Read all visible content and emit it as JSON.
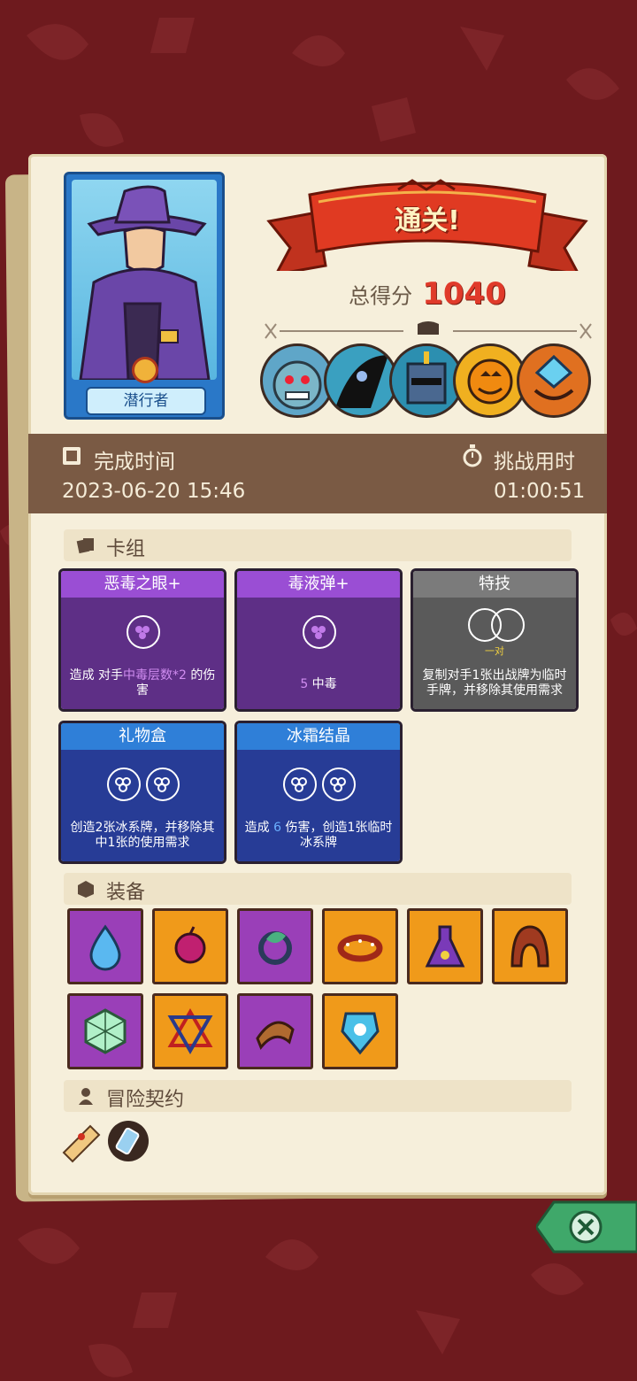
{
  "result": {
    "banner": "通关!",
    "score_label": "总得分",
    "score_value": "1040"
  },
  "hero": {
    "name": "潜行者"
  },
  "time": {
    "finish_label": "完成时间",
    "finish_value": "2023-06-20 15:46",
    "challenge_label": "挑战用时",
    "challenge_value": "01:00:51"
  },
  "deck": {
    "title": "卡组",
    "cards": [
      {
        "name": "恶毒之眼+",
        "color": "purple",
        "desc_prefix": "造成 对手",
        "desc_highlight": "中毒层数*2",
        "desc_suffix": " 的伤害"
      },
      {
        "name": "毒液弹+",
        "color": "purple",
        "desc_value": "5",
        "desc_suffix": " 中毒"
      },
      {
        "name": "特技",
        "color": "gray",
        "slot_label": "一对",
        "desc": "复制对手1张出战牌为临时手牌，并移除其使用需求"
      },
      {
        "name": "礼物盒",
        "color": "blue",
        "desc": "创造2张冰系牌，并移除其中1张的使用需求"
      },
      {
        "name": "冰霜结晶",
        "color": "blue",
        "desc_prefix": "造成 ",
        "desc_value": "6",
        "desc_mid": " 伤害，创造1张临时",
        "desc_suffix": "冰系牌"
      }
    ]
  },
  "equipment": {
    "title": "装备",
    "items": [
      {
        "icon": "water-drop-icon",
        "color": "purple"
      },
      {
        "icon": "poison-apple-icon",
        "color": "orange"
      },
      {
        "icon": "leaf-ring-icon",
        "color": "purple"
      },
      {
        "icon": "spiked-collar-icon",
        "color": "orange"
      },
      {
        "icon": "eye-flask-icon",
        "color": "orange"
      },
      {
        "icon": "hood-icon",
        "color": "orange"
      },
      {
        "icon": "d20-dice-icon",
        "color": "purple"
      },
      {
        "icon": "hexagram-amulet-icon",
        "color": "orange"
      },
      {
        "icon": "leather-bracer-icon",
        "color": "purple"
      },
      {
        "icon": "frost-shield-icon",
        "color": "orange"
      }
    ]
  },
  "contract": {
    "title": "冒险契约",
    "items": [
      "scroll-icon",
      "potion-icon"
    ]
  },
  "colors": {
    "background": "#6e1a1e",
    "score": "#e03a2a",
    "purple_card": "#5e2f86",
    "blue_card": "#273c96",
    "gray_card": "#5a5a5a"
  }
}
